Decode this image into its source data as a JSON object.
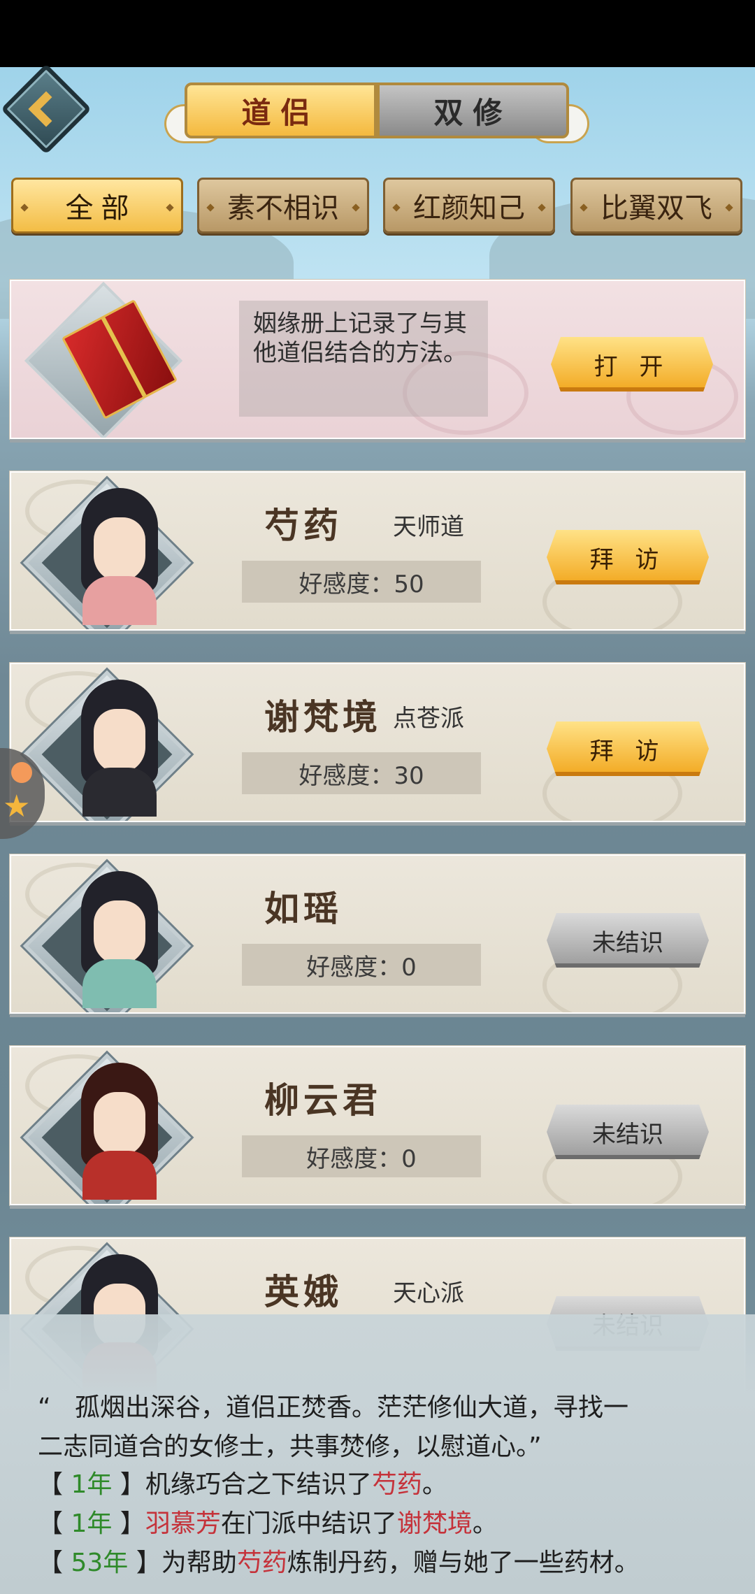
{
  "tabs_top": [
    {
      "label": "道侣",
      "active": true
    },
    {
      "label": "双修",
      "active": false
    }
  ],
  "filters": [
    {
      "label": "全 部",
      "active": true
    },
    {
      "label": "素不相识",
      "active": false
    },
    {
      "label": "红颜知己",
      "active": false
    },
    {
      "label": "比翼双飞",
      "active": false
    }
  ],
  "intro": {
    "text": "姻缘册上记录了与其他道侣结合的方法。",
    "button": "打 开"
  },
  "companions": [
    {
      "name": "芍药",
      "sect": "天师道",
      "affection": "好感度：50",
      "button": "拜 访",
      "button_style": "gold"
    },
    {
      "name": "谢梵境",
      "sect": "点苍派",
      "affection": "好感度：30",
      "button": "拜 访",
      "button_style": "gold"
    },
    {
      "name": "如瑶",
      "sect": "",
      "affection": "好感度：0",
      "button": "未结识",
      "button_style": "gray"
    },
    {
      "name": "柳云君",
      "sect": "",
      "affection": "好感度：0",
      "button": "未结识",
      "button_style": "gray"
    },
    {
      "name": "英娥",
      "sect": "天心派",
      "affection": "",
      "button": "未结识",
      "button_style": "gray"
    }
  ],
  "log": {
    "quote_open": "“",
    "quote_line1": "孤烟出深谷，道侣正焚香。茫茫修仙大道，寻找一",
    "quote_line2": "二志同道合的女修士，共事焚修，以慰道心。”",
    "entries": [
      {
        "year": "1年",
        "actor": "",
        "text_before": "机缘巧合之下结识了",
        "target": "芍药",
        "text_after": "。"
      },
      {
        "year": "1年",
        "actor": "羽慕芳",
        "text_before": "在门派中结识了",
        "target": "谢梵境",
        "text_after": "。"
      },
      {
        "year": "53年",
        "actor": "",
        "text_before": "为帮助",
        "target": "芍药",
        "text_after": "炼制丹药，赠与她了一些药材。"
      }
    ]
  },
  "colors": {
    "gold_button": "#f2a820",
    "gray_button": "#9b9b9b",
    "log_green": "#2f8a2a",
    "log_red": "#c5323a"
  }
}
